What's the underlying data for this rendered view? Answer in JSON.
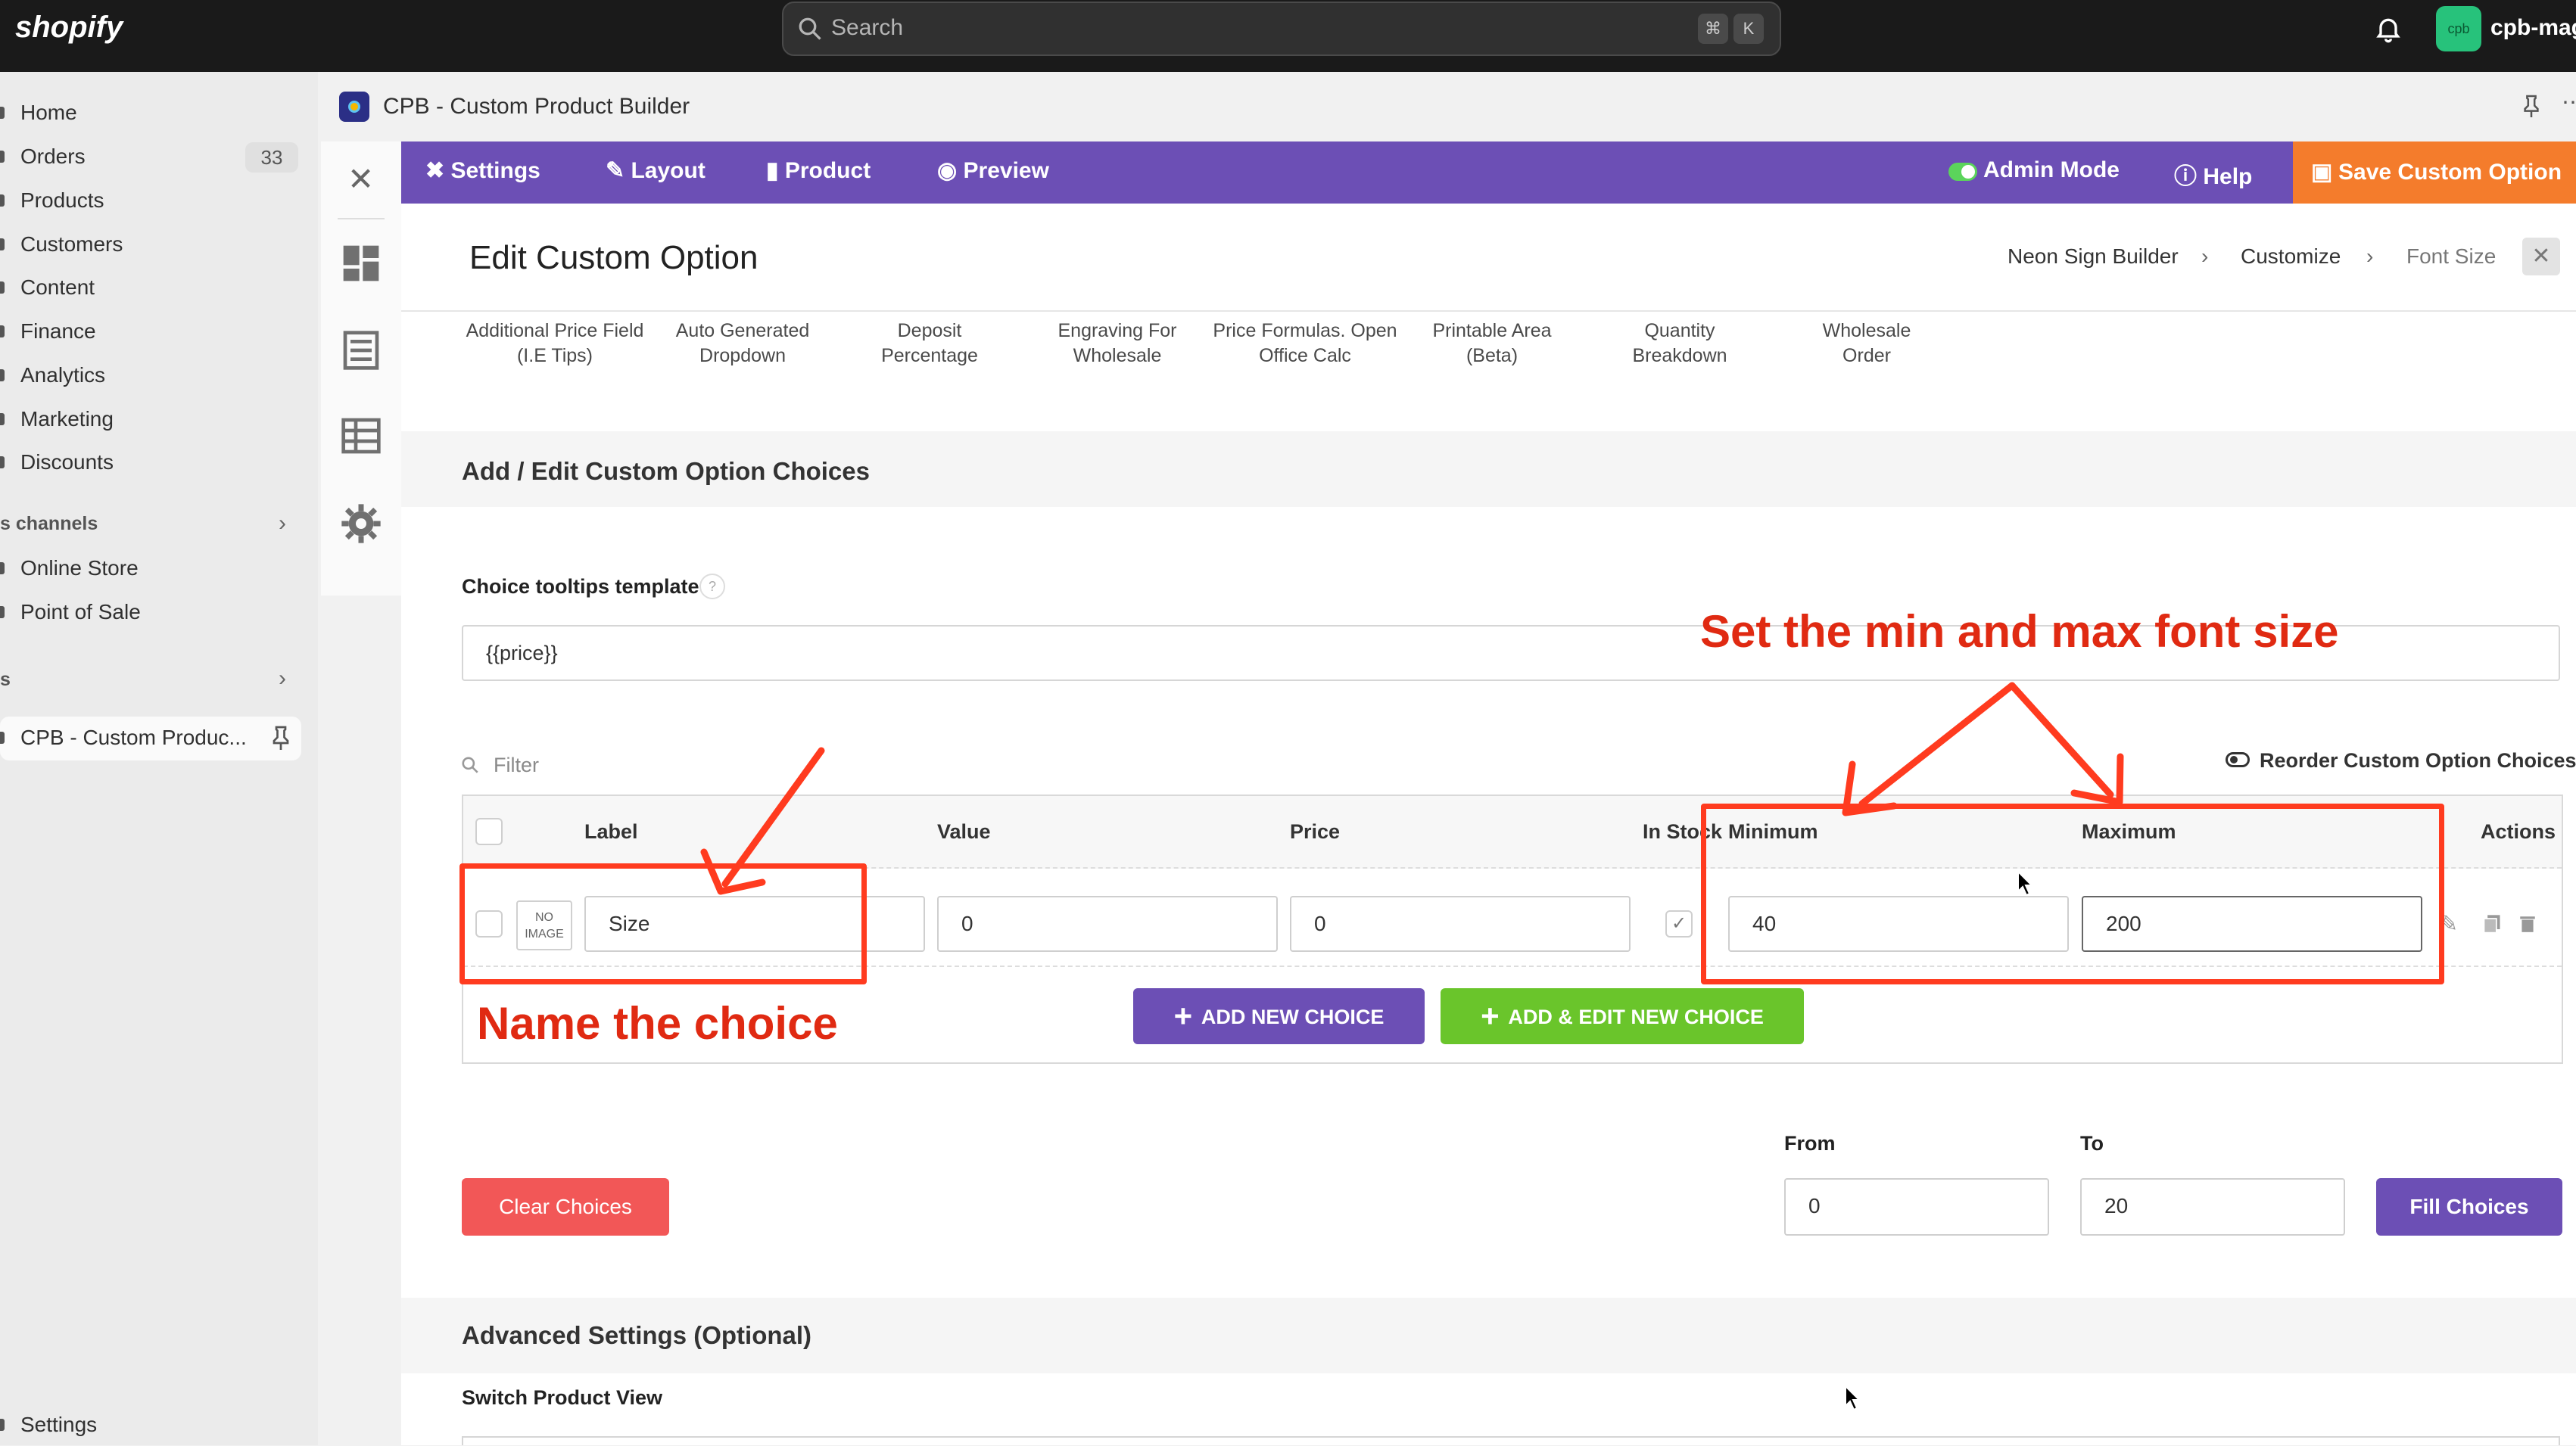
{
  "topbar": {
    "logo": "shopify",
    "search_placeholder": "Search",
    "kbd1": "⌘",
    "kbd2": "K",
    "store_avatar": "cpb",
    "store_name": "cpb-mago"
  },
  "sidebar": {
    "items": [
      {
        "label": "Home"
      },
      {
        "label": "Orders",
        "badge": "33"
      },
      {
        "label": "Products"
      },
      {
        "label": "Customers"
      },
      {
        "label": "Content"
      },
      {
        "label": "Finance"
      },
      {
        "label": "Analytics"
      },
      {
        "label": "Marketing"
      },
      {
        "label": "Discounts"
      }
    ],
    "channels_title": "s channels",
    "channels": [
      {
        "label": "Online Store"
      },
      {
        "label": "Point of Sale"
      }
    ],
    "apps_title": "s",
    "app_item": "CPB - Custom Produc...",
    "settings": "Settings"
  },
  "app": {
    "title": "CPB - Custom Product Builder",
    "toolbar": {
      "settings": "Settings",
      "layout": "Layout",
      "product": "Product",
      "preview": "Preview",
      "admin_mode": "Admin Mode",
      "help": "Help",
      "save": "Save Custom Option"
    },
    "page_title": "Edit Custom Option",
    "breadcrumb": [
      "Neon Sign Builder",
      "Customize",
      "Font Size"
    ],
    "templates": [
      [
        "Additional Price Field",
        "(I.E Tips)"
      ],
      [
        "Auto Generated",
        "Dropdown"
      ],
      [
        "Deposit",
        "Percentage"
      ],
      [
        "Engraving For",
        "Wholesale"
      ],
      [
        "Price Formulas. Open",
        "Office Calc"
      ],
      [
        "Printable Area",
        "(Beta)"
      ],
      [
        "Quantity",
        "Breakdown"
      ],
      [
        "Wholesale",
        "Order"
      ]
    ],
    "choices_section": {
      "title": "Add / Edit Custom Option Choices",
      "tooltip_label": "Choice tooltips template",
      "tooltip_help": "?",
      "tooltip_value": "{{price}}",
      "filter_placeholder": "Filter",
      "reorder": "Reorder Custom Option Choices",
      "columns": {
        "label": "Label",
        "value": "Value",
        "price": "Price",
        "in_stock": "In Stock",
        "minimum": "Minimum",
        "maximum": "Maximum",
        "actions": "Actions"
      },
      "row": {
        "no_image": "NO IMAGE",
        "label": "Size",
        "value": "0",
        "price": "0",
        "minimum": "40",
        "maximum": "200"
      },
      "add_new": "ADD NEW CHOICE",
      "add_edit_new": "ADD & EDIT NEW CHOICE",
      "clear": "Clear Choices",
      "from_label": "From",
      "to_label": "To",
      "from_value": "0",
      "to_value": "20",
      "fill": "Fill Choices"
    },
    "advanced": {
      "title": "Advanced Settings (Optional)",
      "switch_label": "Switch Product View"
    }
  },
  "annotations": {
    "minmax": "Set the min and max font size",
    "name": "Name the choice"
  },
  "colors": {
    "toolbar_purple": "#6c4fb5",
    "save_orange": "#f47c2c",
    "green_button": "#6ac52b",
    "clear_red": "#f25757",
    "annotation_red": "#ff3b1f"
  }
}
